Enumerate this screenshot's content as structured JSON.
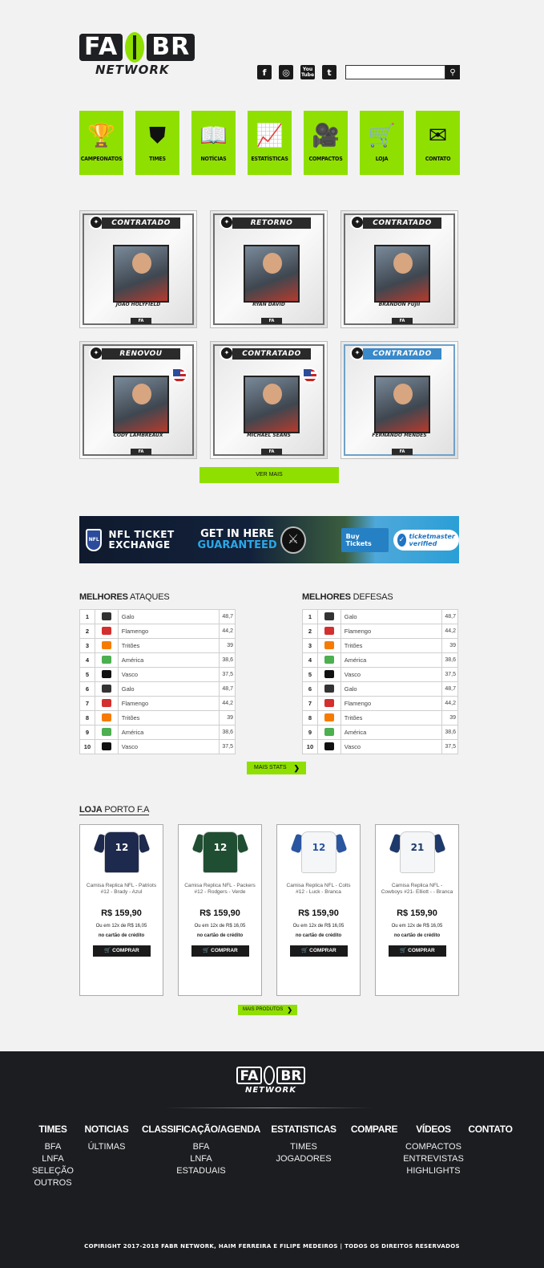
{
  "brand": {
    "logo_main": "FA",
    "logo_main_2": "BR",
    "logo_sub": "NETWORK"
  },
  "social": [
    {
      "name": "facebook",
      "glyph": "f"
    },
    {
      "name": "instagram",
      "glyph": "◎"
    },
    {
      "name": "youtube",
      "glyph": "You Tube"
    },
    {
      "name": "twitter",
      "glyph": "t"
    }
  ],
  "search": {
    "placeholder": "",
    "button_icon": "search-icon"
  },
  "nav": [
    {
      "label": "CAMPEONATOS",
      "icon": "trophy-icon",
      "glyph": "🏆"
    },
    {
      "label": "TIMES",
      "icon": "shield-icon",
      "glyph": "⛊"
    },
    {
      "label": "NOTÍCIAS",
      "icon": "book-icon",
      "glyph": "📖"
    },
    {
      "label": "ESTATÍSTICAS",
      "icon": "chart-icon",
      "glyph": "📈"
    },
    {
      "label": "COMPACTOS",
      "icon": "camera-icon",
      "glyph": "🎥"
    },
    {
      "label": "LOJA",
      "icon": "cart-icon",
      "glyph": "🛒"
    },
    {
      "label": "CONTATO",
      "icon": "mail-icon",
      "glyph": "✉"
    }
  ],
  "players": [
    {
      "status": "CONTRATADO",
      "name": "JOÃO HOLYFIELD",
      "flag": false,
      "style": "default"
    },
    {
      "status": "RETORNO",
      "name": "RYAN DAVID",
      "flag": false,
      "style": "default"
    },
    {
      "status": "CONTRATADO",
      "name": "BRANDON FUJII",
      "flag": false,
      "style": "default"
    },
    {
      "status": "RENOVOU",
      "name": "CODY LAMBREAUX",
      "flag": true,
      "style": "default"
    },
    {
      "status": "CONTRATADO",
      "name": "MICHAEL SEANS",
      "flag": true,
      "style": "default"
    },
    {
      "status": "CONTRATADO",
      "name": "FERNANDO MENDES",
      "flag": false,
      "style": "blue"
    }
  ],
  "ver_mais": "VER MAIS",
  "banner": {
    "line1": "NFL TICKET",
    "line2": "EXCHANGE",
    "get": "GET IN HERE",
    "guaranteed": "GUARANTEED",
    "buy": "Buy Tickets",
    "tm": "ticketmaster verified"
  },
  "stats": {
    "ataques_bold": "MELHORES",
    "ataques_rest": " ATAQUES",
    "defesas_bold": "MELHORES",
    "defesas_rest": " DEFESAS",
    "rows": [
      {
        "pos": "1",
        "team": "Galo",
        "value": "48,7",
        "color": "#333333"
      },
      {
        "pos": "2",
        "team": "Flamengo",
        "value": "44,2",
        "color": "#d32f2f"
      },
      {
        "pos": "3",
        "team": "Tritões",
        "value": "39",
        "color": "#f57c00"
      },
      {
        "pos": "4",
        "team": "América",
        "value": "38,6",
        "color": "#4caf50"
      },
      {
        "pos": "5",
        "team": "Vasco",
        "value": "37,5",
        "color": "#111111"
      },
      {
        "pos": "6",
        "team": "Galo",
        "value": "48,7",
        "color": "#333333"
      },
      {
        "pos": "7",
        "team": "Flamengo",
        "value": "44,2",
        "color": "#d32f2f"
      },
      {
        "pos": "8",
        "team": "Tritões",
        "value": "39",
        "color": "#f57c00"
      },
      {
        "pos": "9",
        "team": "América",
        "value": "38,6",
        "color": "#4caf50"
      },
      {
        "pos": "10",
        "team": "Vasco",
        "value": "37,5",
        "color": "#111111"
      }
    ],
    "mais_stats": "MAIS STATS"
  },
  "loja": {
    "title_bold": "LOJA",
    "title_rest": " PORTO F.A",
    "products": [
      {
        "name": "Camisa Replica NFL - Patriots #12 - Brady - Azul",
        "price": "R$ 159,90",
        "installments": "Ou em 12x de R$ 16,05",
        "card": "no cartão de crédito",
        "buy": "COMPRAR",
        "number": "12",
        "color": "#1d2a4d",
        "sleeve": "#1d2a4d"
      },
      {
        "name": "Camisa Replica NFL - Packers #12 - Rodgers - Verde",
        "price": "R$ 159,90",
        "installments": "Ou em 12x de R$ 16,05",
        "card": "no cartão de crédito",
        "buy": "COMPRAR",
        "number": "12",
        "color": "#204e32",
        "sleeve": "#204e32"
      },
      {
        "name": "Camisa Replica NFL - Colts #12 - Luck - Branca",
        "price": "R$ 159,90",
        "installments": "Ou em 12x de R$ 16,05",
        "card": "no cartão de crédito",
        "buy": "COMPRAR",
        "number": "12",
        "color": "#f4f6f8",
        "sleeve": "#2a55a0"
      },
      {
        "name": "Camisa Replica NFL - Cowboys #21- Elliott - - Branca",
        "price": "R$ 159,90",
        "installments": "Ou em 12x de R$ 16,05",
        "card": "no cartão de crédito",
        "buy": "COMPRAR",
        "number": "21",
        "color": "#f4f6f8",
        "sleeve": "#1e3a6a"
      }
    ],
    "mais_produtos": "MAIS PRODUTOS"
  },
  "footer": {
    "columns": [
      {
        "head": "TIMES",
        "items": [
          "BFA",
          "LNFA",
          "SELEÇÃO",
          "OUTROS"
        ]
      },
      {
        "head": "NOTICIAS",
        "items": [
          "ÚLTIMAS"
        ]
      },
      {
        "head": "CLASSIFICAÇÃO/AGENDA",
        "items": [
          "BFA",
          "LNFA",
          "ESTADUAIS"
        ]
      },
      {
        "head": "ESTATISTICAS",
        "items": [
          "TIMES",
          "JOGADORES"
        ]
      },
      {
        "head": "COMPARE",
        "items": []
      },
      {
        "head": "VÍDEOS",
        "items": [
          "COMPACTOS",
          "ENTREVISTAS",
          "HIGHLIGHTS"
        ]
      },
      {
        "head": "CONTATO",
        "items": []
      }
    ],
    "copyright": "COPIRIGHT 2017-2018 FABR NETWORK, HAIM FERREIRA E FILIPE MEDEIROS  |  TODOS OS DIREITOS RESERVADOS"
  }
}
